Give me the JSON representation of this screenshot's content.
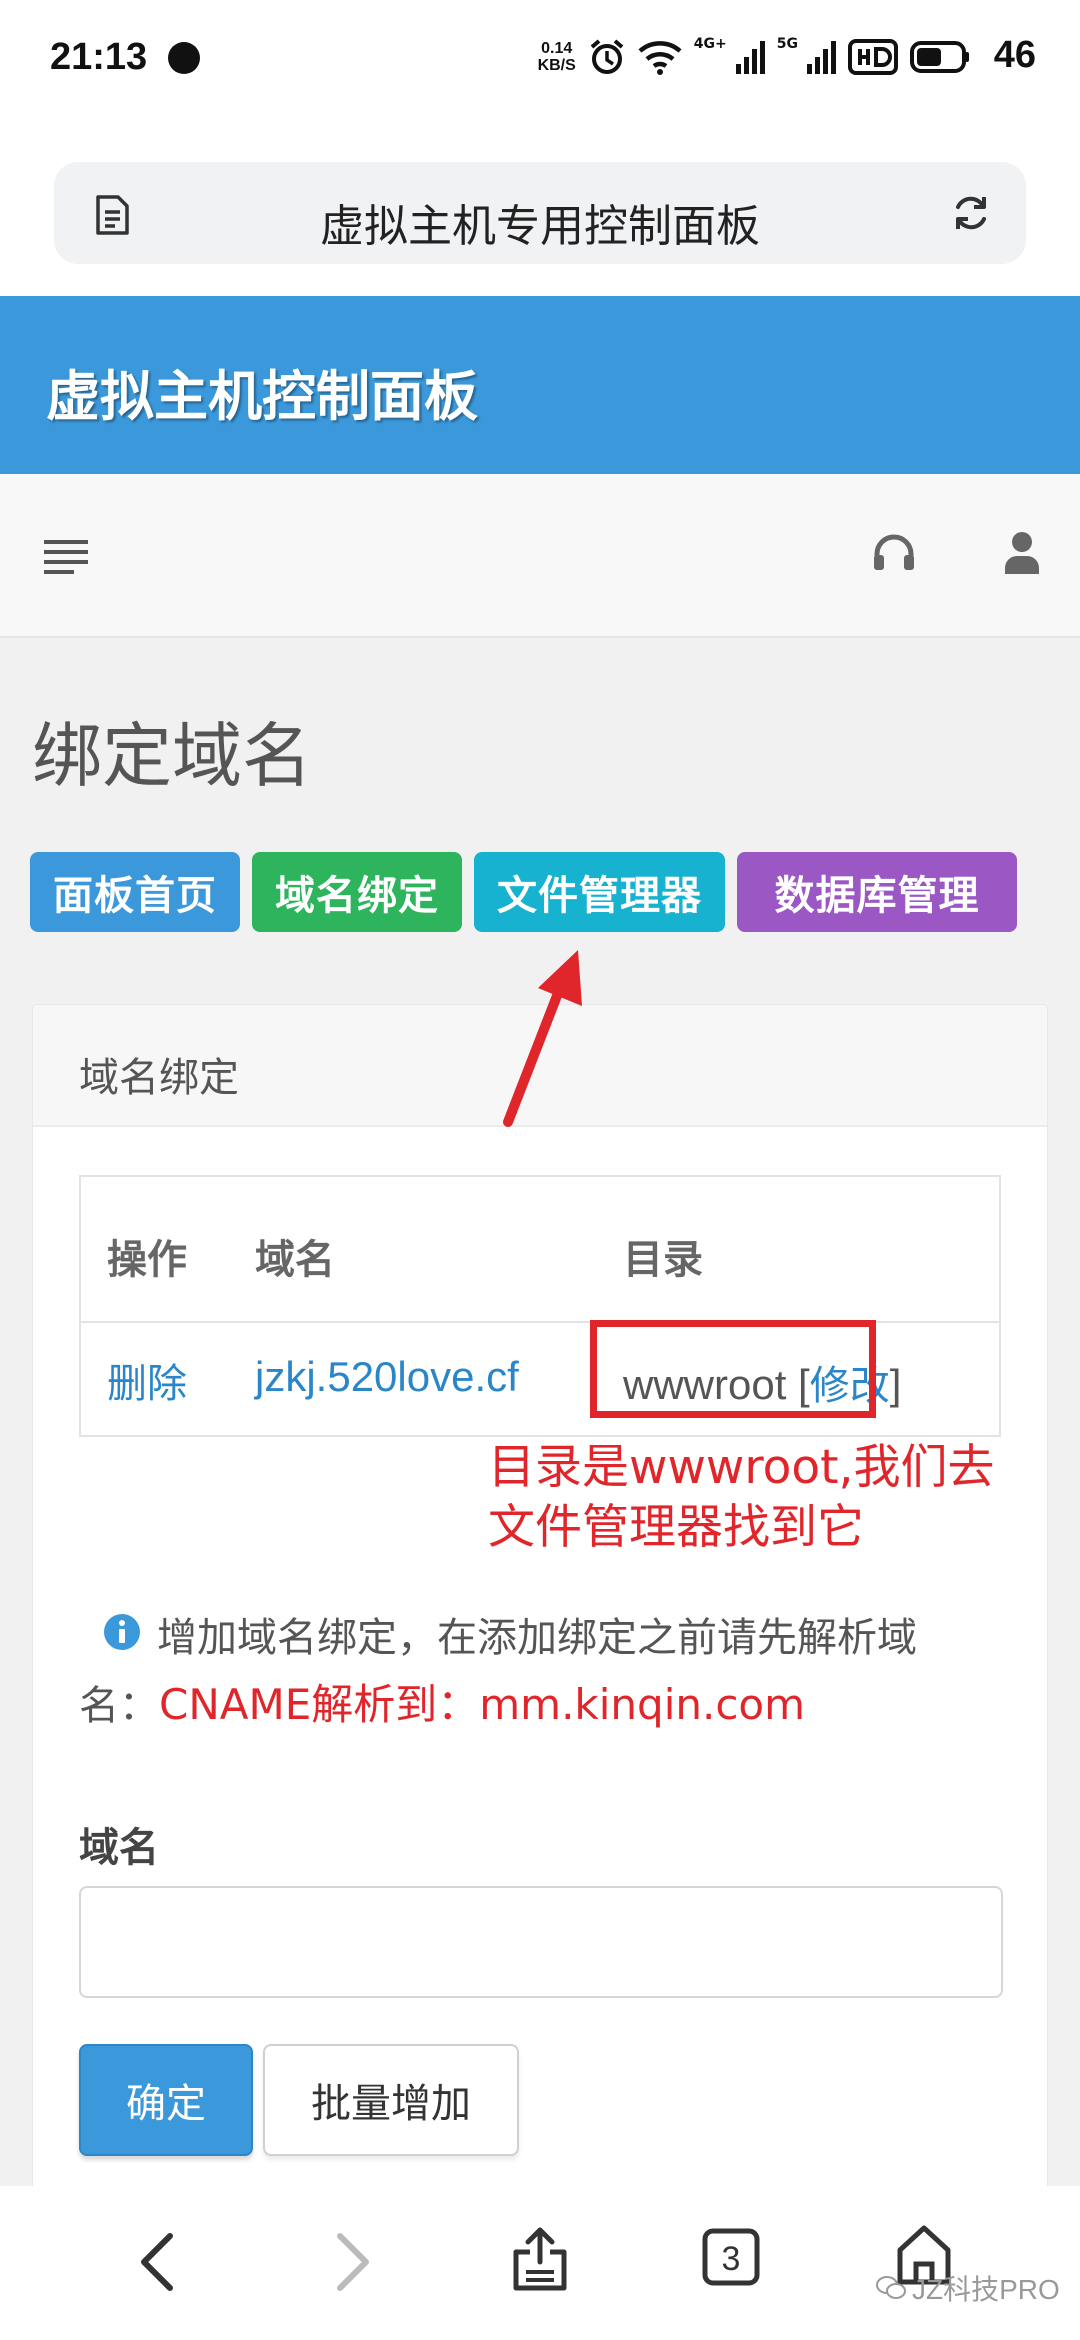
{
  "status_bar": {
    "time": "21:13",
    "net_speed_value": "0.14",
    "net_speed_unit": "KB/S",
    "signal1_label": "4G+",
    "signal2_label": "5G",
    "battery": "46"
  },
  "browser": {
    "url_title": "虚拟主机专用控制面板",
    "tab_count": "3"
  },
  "app": {
    "title": "虚拟主机控制面板"
  },
  "page": {
    "title": "绑定域名",
    "nav_buttons": [
      {
        "label": "面板首页",
        "color": "#3b98da"
      },
      {
        "label": "域名绑定",
        "color": "#2db45c"
      },
      {
        "label": "文件管理器",
        "color": "#17b2cf"
      },
      {
        "label": "数据库管理",
        "color": "#9b57c3"
      }
    ]
  },
  "card": {
    "title": "域名绑定",
    "table": {
      "headers": [
        "操作",
        "域名",
        "目录"
      ],
      "rows": [
        {
          "action": "删除",
          "domain": "jzkj.520love.cf",
          "dir": "wwwroot",
          "dir_open": "[",
          "modify": "修改",
          "dir_close": "]"
        }
      ]
    },
    "annotation": {
      "line1": "目录是wwwroot,我们去",
      "line2": "文件管理器找到它"
    },
    "info": {
      "line1": "增加域名绑定，在添加绑定之前请先解析域",
      "line2_prefix": "名：",
      "line2_red": "CNAME解析到：mm.kinqin.com"
    },
    "form": {
      "label": "域名",
      "input_value": "",
      "ok_label": "确定",
      "batch_label": "批量增加"
    }
  },
  "watermark": "JZ科技PRO",
  "colors": {
    "header_blue": "#3b98da",
    "annotation_red": "#e0262b",
    "link_blue": "#2a86c8"
  }
}
